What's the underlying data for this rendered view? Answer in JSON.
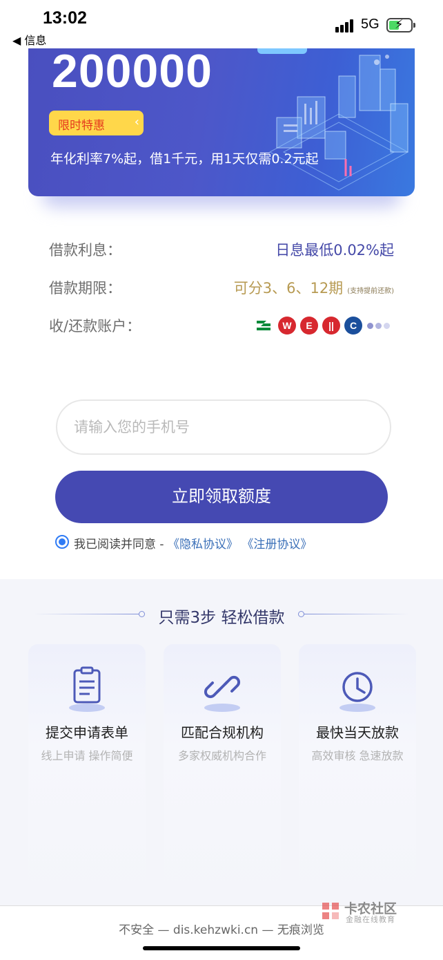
{
  "status_bar": {
    "time": "13:02",
    "back_label": "◀ 信息",
    "network": "5G"
  },
  "banner": {
    "amount": "200000",
    "promo_label": "限时特惠",
    "rate_text": "年化利率7%起，借1千元，用1天仅需0.2元起",
    "colors": {
      "bg": "#4a4fbf",
      "promo": "#ffd74a",
      "promo_text": "#e53a1e"
    }
  },
  "info": {
    "interest_label": "借款利息：",
    "interest_value": "日息最低0.02%起",
    "term_label": "借款期限：",
    "term_value": "可分3、6、12期",
    "term_note": "(支持提前还款)",
    "account_label": "收/还款账户：",
    "bank_icons": [
      "postal-bank-icon",
      "icbc-bank-icon",
      "cmbc-bank-icon",
      "citic-bank-icon",
      "ccb-bank-icon"
    ]
  },
  "form": {
    "phone_placeholder": "请输入您的手机号",
    "submit_label": "立即领取额度",
    "agree_text": "我已阅读并同意 - ",
    "privacy_link": "《隐私协议》",
    "register_link": "《注册协议》",
    "accent": "#4549b2"
  },
  "steps": {
    "title": "只需3步  轻松借款",
    "items": [
      {
        "title": "提交申请表单",
        "subtitle": "线上申请 操作简便",
        "icon": "clipboard-icon"
      },
      {
        "title": "匹配合规机构",
        "subtitle": "多家权威机构合作",
        "icon": "link-icon"
      },
      {
        "title": "最快当天放款",
        "subtitle": "高效审核 急速放款",
        "icon": "clock-icon"
      }
    ]
  },
  "browser": {
    "url_text": "不安全 — dis.kehzwki.cn — 无痕浏览"
  },
  "watermark": {
    "name": "卡农社区",
    "tagline": "金融在线教育"
  }
}
